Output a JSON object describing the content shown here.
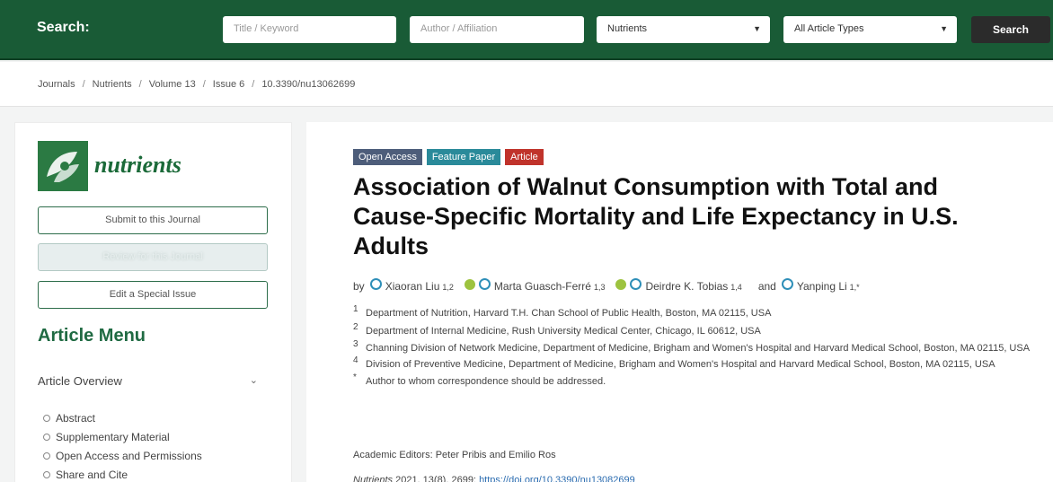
{
  "search": {
    "label": "Search:",
    "title_placeholder": "Title / Keyword",
    "author_placeholder": "Author / Affiliation",
    "journal_value": "Nutrients",
    "type_value": "All Article Types",
    "button": "Search"
  },
  "breadcrumb": [
    "Journals",
    "Nutrients",
    "Volume 13",
    "Issue 6",
    "10.3390/nu13062699"
  ],
  "sidebar": {
    "brand": "nutrients",
    "submit_button": "Submit to this Journal",
    "review_button": "Review for this Journal",
    "special_issue_button": "Edit a Special Issue",
    "menu_title": "Article Menu",
    "overview": "Article Overview",
    "items": [
      "Abstract",
      "Supplementary Material",
      "Open Access and Permissions",
      "Share and Cite"
    ]
  },
  "article": {
    "badges": [
      "Open Access",
      "Feature Paper",
      "Article"
    ],
    "title": "Association of Walnut Consumption with Total and Cause-Specific Mortality and Life Expectancy in U.S. Adults",
    "by": "by",
    "and": "and",
    "authors": [
      {
        "name": "Xiaoran Liu",
        "sup": "1,2"
      },
      {
        "name": "Marta Guasch-Ferré",
        "sup": "1,3"
      },
      {
        "name": "Deirdre K. Tobias",
        "sup": "1,4"
      },
      {
        "name": "Yanping Li",
        "sup": "1,*"
      }
    ],
    "affiliations": [
      {
        "num": "1",
        "text": "Department of Nutrition, Harvard T.H. Chan School of Public Health, Boston, MA 02115, USA"
      },
      {
        "num": "2",
        "text": "Department of Internal Medicine, Rush University Medical Center, Chicago, IL 60612, USA"
      },
      {
        "num": "3",
        "text": "Channing Division of Network Medicine, Department of Medicine, Brigham and Women's Hospital and Harvard Medical School, Boston, MA 02115, USA"
      },
      {
        "num": "4",
        "text": "Division of Preventive Medicine, Department of Medicine, Brigham and Women's Hospital and Harvard Medical School, Boston, MA 02115, USA"
      },
      {
        "num": "*",
        "text": "Author to whom correspondence should be addressed."
      }
    ],
    "editors": "Academic Editors: Peter Pribis and Emilio Ros",
    "footline_journal": "Nutrients",
    "footline_rest": " 2021, 13(8), 2699;",
    "footline_link": "https://doi.org/10.3390/nu13082699"
  },
  "colors": {
    "header_green": "#195b36",
    "accent_green": "#1f6a42",
    "badge_open": "#4d5d7a",
    "badge_feature": "#2a8a9a",
    "badge_article": "#c0332b"
  }
}
